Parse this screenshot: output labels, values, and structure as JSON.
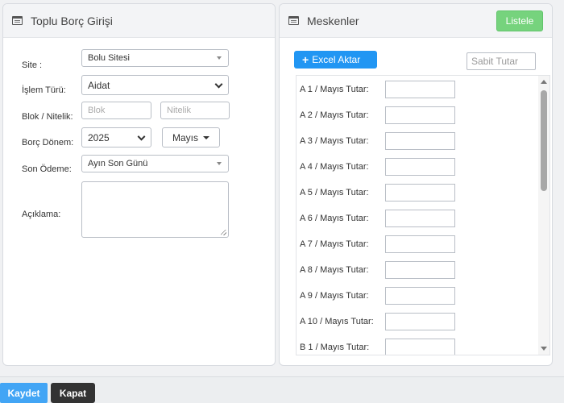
{
  "left_panel": {
    "title": "Toplu Borç Girişi",
    "site": {
      "label": "Site :",
      "value": "Bolu Sitesi"
    },
    "islem_turu": {
      "label": "İşlem Türü:",
      "value": "Aidat"
    },
    "blok_nitelik": {
      "label": "Blok / Nitelik:",
      "blok_placeholder": "Blok",
      "nitelik_placeholder": "Nitelik"
    },
    "borc_donem": {
      "label": "Borç Dönem:",
      "year": "2025",
      "month": "Mayıs"
    },
    "son_odeme": {
      "label": "Son Ödeme:",
      "value": "Ayın Son Günü"
    },
    "aciklama": {
      "label": "Açıklama:",
      "value": ""
    }
  },
  "right_panel": {
    "title": "Meskenler",
    "listele_label": "Listele",
    "excel_label": "Excel Aktar",
    "sabit_tutar_placeholder": "Sabit Tutar",
    "rows": [
      "A 1 / Mayıs Tutar:",
      "A 2 / Mayıs Tutar:",
      "A 3 / Mayıs Tutar:",
      "A 4 / Mayıs Tutar:",
      "A 5 / Mayıs Tutar:",
      "A 6 / Mayıs Tutar:",
      "A 7 / Mayıs Tutar:",
      "A 8 / Mayıs Tutar:",
      "A 9 / Mayıs Tutar:",
      "A 10 / Mayıs Tutar:",
      "B 1 / Mayıs Tutar:"
    ]
  },
  "footer": {
    "save_label": "Kaydet",
    "close_label": "Kapat"
  }
}
